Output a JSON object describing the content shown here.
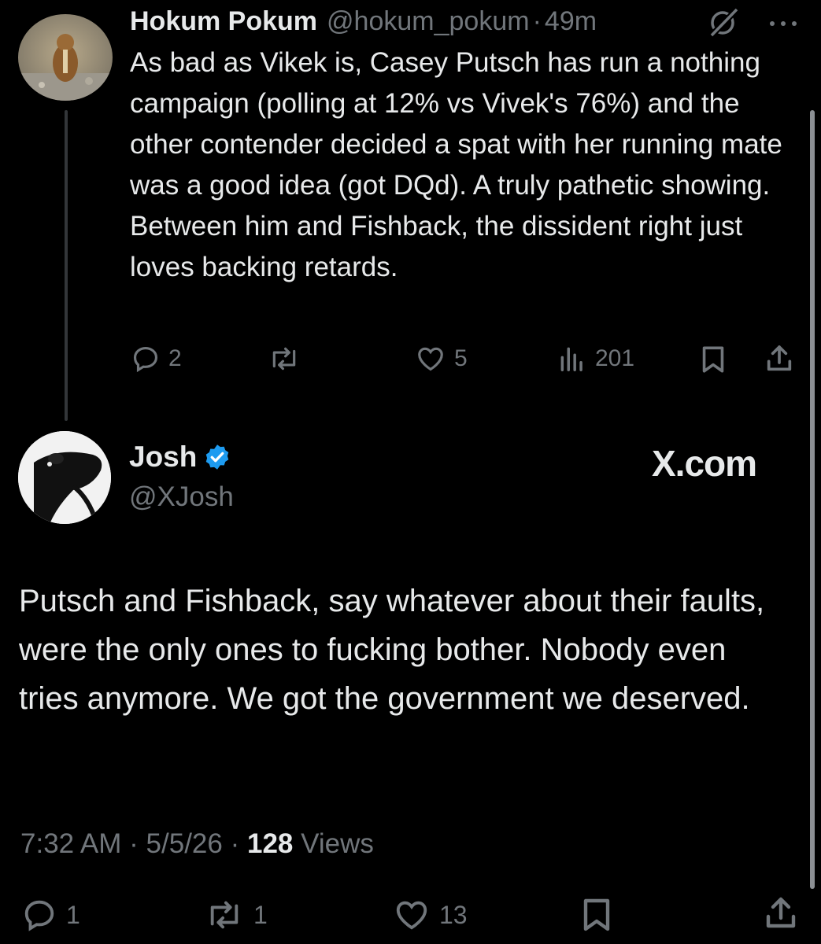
{
  "parent_tweet": {
    "display_name": "Hokum Pokum",
    "handle": "@hokum_pokum",
    "separator": "·",
    "time": "49m",
    "text": "As bad as Vikek is, Casey Putsch has run a nothing campaign (polling at 12% vs Vivek's 76%) and the other contender decided a spat with her running mate was a good idea (got DQd). A truly pathetic showing. Between him and Fishback, the dissident right just loves backing retards.",
    "replies": "2",
    "likes": "5",
    "views": "201"
  },
  "reply_tweet": {
    "display_name": "Josh",
    "handle": "@XJosh",
    "watermark": "X.com",
    "text": "Putsch and Fishback, say whatever about their faults, were the only ones to fucking bother. Nobody even tries anymore. We got the government we deserved.",
    "time": "7:32 AM",
    "date": "5/5/26",
    "separator": "·",
    "views_count": "128",
    "views_label": "Views",
    "replies": "1",
    "reposts": "1",
    "likes": "13"
  },
  "colors": {
    "background": "#000000",
    "text": "#e7e9ea",
    "muted": "#71767b",
    "verified": "#1d9bf0"
  },
  "icons": [
    "reply-icon",
    "repost-icon",
    "like-icon",
    "views-icon",
    "bookmark-icon",
    "share-icon",
    "grok-icon",
    "more-icon",
    "verified-badge-icon"
  ]
}
